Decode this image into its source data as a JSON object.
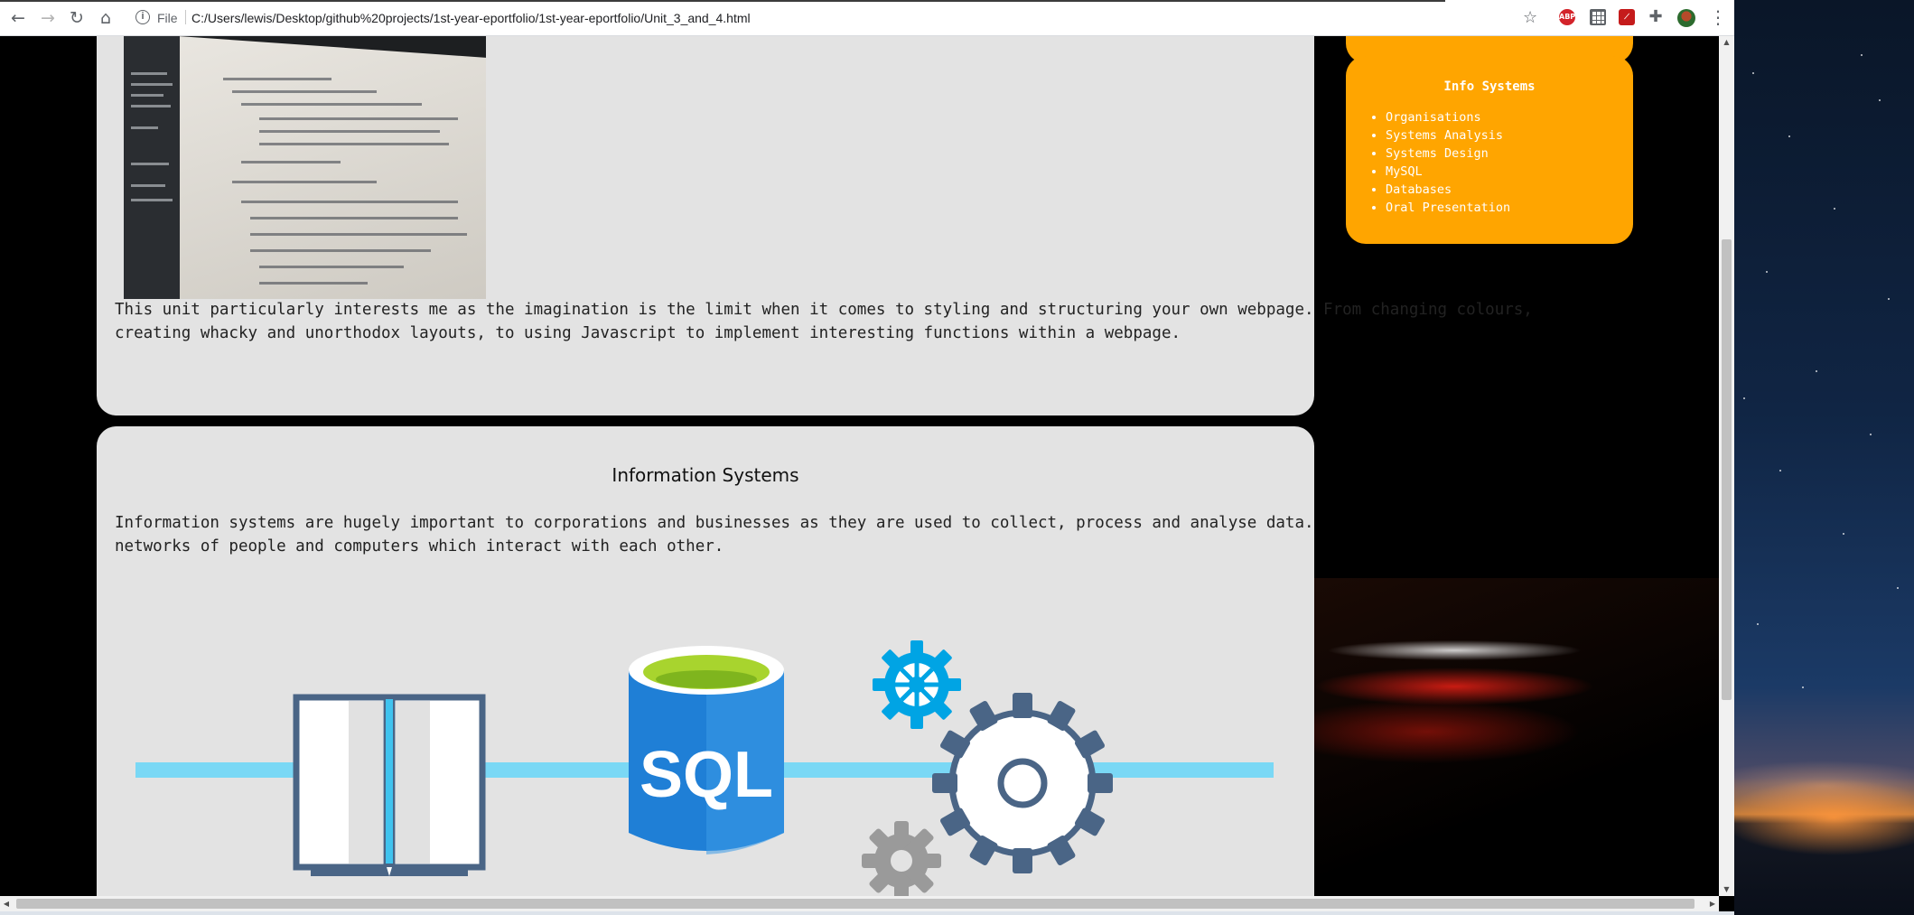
{
  "browser": {
    "scheme_label": "File",
    "url": "C:/Users/lewis/Desktop/github%20projects/1st-year-eportfolio/1st-year-eportfolio/Unit_3_and_4.html",
    "extensions": [
      "abp-icon",
      "grid-extension-icon",
      "pdf-extension-icon",
      "puzzle-icon"
    ],
    "ext_abp_text": "ABP"
  },
  "web_dev_card": {
    "paragraph_lines": [
      "This unit particularly interests me as the imagination is the limit when it comes to styling and structuring your own webpage. From changing colours,",
      "creating whacky and unorthodox layouts, to using Javascript to implement interesting functions within a webpage."
    ]
  },
  "info_systems_card": {
    "heading": "Information Systems",
    "paragraph_lines": [
      "Information systems are hugely important to corporations and businesses as they are used to collect, process and analyse data. They usually consist of",
      "networks of people and computers which interact with each other."
    ],
    "illustration": {
      "sql_label": "SQL",
      "icons": [
        "open-book-icon",
        "sql-database-icon",
        "small-blue-gear-icon",
        "large-gear-icon",
        "grey-gear-icon"
      ]
    }
  },
  "sidebar": {
    "title": "Info Systems",
    "items": [
      "Organisations",
      "Systems Analysis",
      "Systems Design",
      "MySQL",
      "Databases",
      "Oral Presentation"
    ]
  },
  "colors": {
    "card_bg": "#e3e3e3",
    "sidebar_bg": "#ffa500",
    "rail": "#7ad8f5",
    "sql_blue": "#0072c6",
    "gear_blue": "#00a4e4"
  }
}
